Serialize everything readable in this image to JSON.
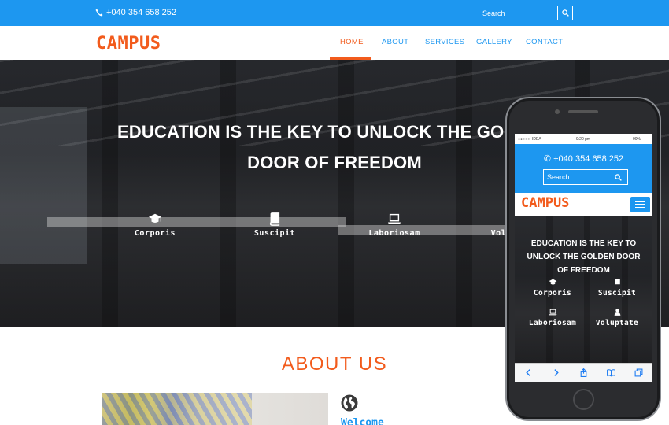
{
  "topbar": {
    "phone_number": "+040 354 658 252",
    "search_placeholder": "Search"
  },
  "header": {
    "logo": "CAMPUS",
    "nav": [
      {
        "label": "HOME",
        "active": true
      },
      {
        "label": "ABOUT",
        "active": false
      },
      {
        "label": "SERVICES",
        "active": false
      },
      {
        "label": "GALLERY",
        "active": false
      },
      {
        "label": "CONTACT",
        "active": false
      }
    ]
  },
  "hero": {
    "title_line1": "EDUCATION IS THE KEY TO UNLOCK THE GOLDEN",
    "title_line2": "DOOR OF FREEDOM",
    "features": [
      {
        "label": "Corporis",
        "icon": "graduation-cap-icon"
      },
      {
        "label": "Suscipit",
        "icon": "book-icon"
      },
      {
        "label": "Laboriosam",
        "icon": "laptop-icon"
      },
      {
        "label": "Voluptate",
        "icon": "user-icon"
      }
    ]
  },
  "about": {
    "title": "ABOUT US",
    "welcome": "Welcome",
    "icon": "globe-icon"
  },
  "mobile": {
    "status": {
      "carrier": "IDEA",
      "time": "9:20 pm",
      "battery": "90%"
    },
    "phone_number": "+040 354 658 252",
    "search_placeholder": "Search",
    "logo": "CAMPUS",
    "hero_title": "EDUCATION IS THE KEY TO UNLOCK THE GOLDEN DOOR OF FREEDOM",
    "features": [
      {
        "label": "Corporis",
        "icon": "graduation-cap-icon"
      },
      {
        "label": "Suscipit",
        "icon": "book-icon"
      },
      {
        "label": "Laboriosam",
        "icon": "laptop-icon"
      },
      {
        "label": "Voluptate",
        "icon": "user-icon"
      }
    ]
  },
  "colors": {
    "primary": "#1d97f0",
    "accent": "#f25b1c",
    "text_on_dark": "#ffffff"
  }
}
